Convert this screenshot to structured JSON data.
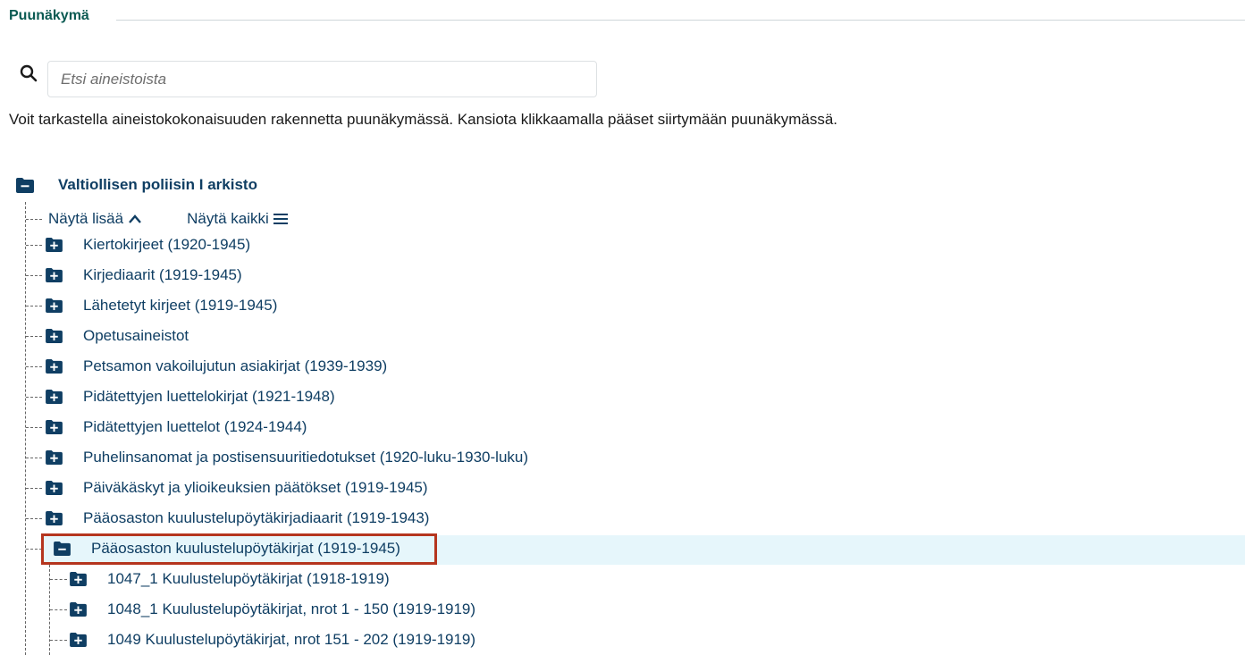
{
  "section": {
    "title": "Puunäkymä"
  },
  "search": {
    "placeholder": "Etsi aineistoista",
    "icon": "search-icon"
  },
  "info_text": "Voit tarkastella aineistokokonaisuuden rakennetta puunäkymässä. Kansiota klikkaamalla pääset siirtymään puunäkymässä.",
  "tree": {
    "root": {
      "label": "Valtiollisen poliisin I arkisto",
      "icon": "folder-minus-icon"
    },
    "controls": {
      "show_more": "Näytä lisää",
      "show_more_icon": "chevron-up-icon",
      "show_all": "Näytä kaikki",
      "show_all_icon": "list-icon"
    },
    "children": [
      {
        "label": "Kiertokirjeet (1920-1945)",
        "icon": "folder-plus-icon"
      },
      {
        "label": "Kirjediaarit (1919-1945)",
        "icon": "folder-plus-icon"
      },
      {
        "label": "Lähetetyt kirjeet (1919-1945)",
        "icon": "folder-plus-icon"
      },
      {
        "label": "Opetusaineistot",
        "icon": "folder-plus-icon"
      },
      {
        "label": "Petsamon vakoilujutun asiakirjat (1939-1939)",
        "icon": "folder-plus-icon"
      },
      {
        "label": "Pidätettyjen luettelokirjat (1921-1948)",
        "icon": "folder-plus-icon"
      },
      {
        "label": "Pidätettyjen luettelot (1924-1944)",
        "icon": "folder-plus-icon"
      },
      {
        "label": "Puhelinsanomat ja postisensuuritiedotukset (1920-luku-1930-luku)",
        "icon": "folder-plus-icon"
      },
      {
        "label": "Päiväkäskyt ja ylioikeuksien päätökset (1919-1945)",
        "icon": "folder-plus-icon"
      },
      {
        "label": "Pääosaston kuulustelupöytäkirjadiaarit (1919-1943)",
        "icon": "folder-plus-icon"
      }
    ],
    "selected": {
      "label": "Pääosaston kuulustelupöytäkirjat (1919-1945)",
      "icon": "folder-minus-icon",
      "children": [
        {
          "label": "1047_1 Kuulustelupöytäkirjat (1918-1919)",
          "icon": "folder-plus-icon"
        },
        {
          "label": "1048_1 Kuulustelupöytäkirjat, nrot 1 - 150 (1919-1919)",
          "icon": "folder-plus-icon"
        },
        {
          "label": "1049 Kuulustelupöytäkirjat, nrot 151 - 202 (1919-1919)",
          "icon": "folder-plus-icon"
        }
      ]
    }
  },
  "colors": {
    "heading": "#0b5a52",
    "link": "#0f3e63",
    "icon": "#0f3e63",
    "selected_bg": "#e6f6fb",
    "highlight_border": "#b5351e"
  }
}
